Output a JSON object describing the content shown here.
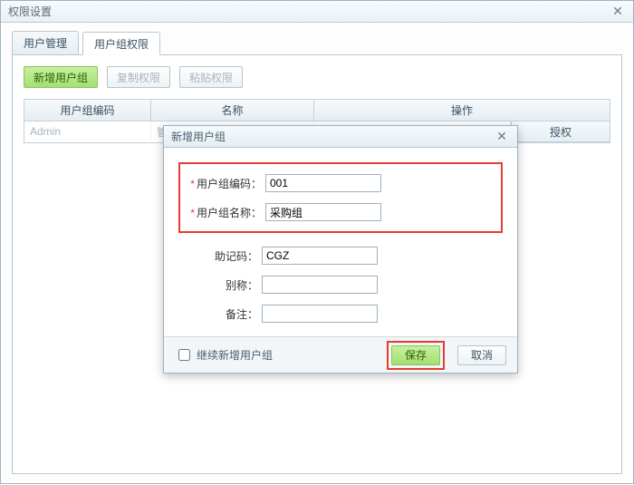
{
  "window": {
    "title": "权限设置"
  },
  "tabs": {
    "user_mgmt": "用户管理",
    "group_perm": "用户组权限"
  },
  "toolbar": {
    "add_group": "新增用户组",
    "copy_perm": "复制权限",
    "paste_perm": "粘贴权限"
  },
  "table": {
    "head": {
      "code": "用户组编码",
      "name": "名称",
      "op": "操作"
    },
    "row0": {
      "code": "Admin",
      "name": "管",
      "action": "授权"
    }
  },
  "dialog": {
    "title": "新增用户组",
    "labels": {
      "code": "用户组编码：",
      "name": "用户组名称：",
      "mnemonic": "助记码：",
      "alias": "别称：",
      "remark": "备注："
    },
    "values": {
      "code": "001",
      "name": "采购组",
      "mnemonic": "CGZ",
      "alias": "",
      "remark": ""
    },
    "continue_label": "继续新增用户组",
    "save": "保存",
    "cancel": "取消"
  },
  "icons": {
    "close": "✕"
  }
}
